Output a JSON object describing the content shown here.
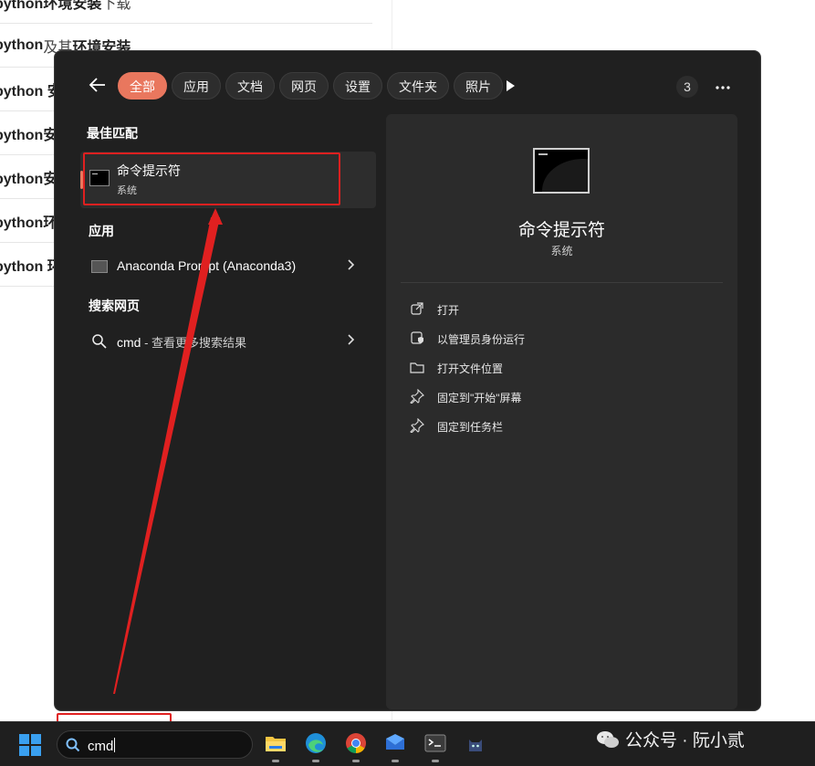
{
  "background_page": {
    "items": [
      {
        "bold": "python环境安装",
        "light": "下载"
      },
      {
        "bold": "python",
        "light": "及其",
        "bold2": "环境安装"
      },
      {
        "bold": "python 安",
        "light": ""
      },
      {
        "bold": "python安",
        "light": ""
      },
      {
        "bold": "python安",
        "light": ""
      },
      {
        "bold": "python环",
        "light": ""
      },
      {
        "bold": "python 环",
        "light": ""
      }
    ]
  },
  "start_menu": {
    "filters": [
      {
        "label": "全部",
        "active": true
      },
      {
        "label": "应用",
        "active": false
      },
      {
        "label": "文档",
        "active": false
      },
      {
        "label": "网页",
        "active": false
      },
      {
        "label": "设置",
        "active": false
      },
      {
        "label": "文件夹",
        "active": false
      },
      {
        "label": "照片",
        "active": false
      }
    ],
    "count_badge": "3",
    "sections": {
      "best_match": "最佳匹配",
      "apps": "应用",
      "web": "搜索网页"
    },
    "best_match": {
      "title": "命令提示符",
      "subtitle": "系统"
    },
    "apps": [
      {
        "label": "Anaconda Prompt (Anaconda3)"
      }
    ],
    "web": {
      "query": "cmd",
      "suffix": " - 查看更多搜索结果"
    },
    "detail": {
      "title": "命令提示符",
      "subtitle": "系统",
      "actions": [
        {
          "label": "打开",
          "icon": "open-external-icon"
        },
        {
          "label": "以管理员身份运行",
          "icon": "shield-icon"
        },
        {
          "label": "打开文件位置",
          "icon": "folder-icon"
        },
        {
          "label": "固定到\"开始\"屏幕",
          "icon": "pin-icon"
        },
        {
          "label": "固定到任务栏",
          "icon": "pin-icon"
        }
      ]
    }
  },
  "taskbar": {
    "search_value": "cmd",
    "apps": [
      "file-explorer-icon",
      "edge-icon",
      "chrome-icon",
      "terminal-app-icon",
      "terminal-icon",
      "cat-app-icon"
    ]
  },
  "watermark": "公众号 · 阮小贰",
  "colors": {
    "accent": "#e9775e",
    "annotation": "#e02020",
    "menu_bg": "#202020"
  }
}
